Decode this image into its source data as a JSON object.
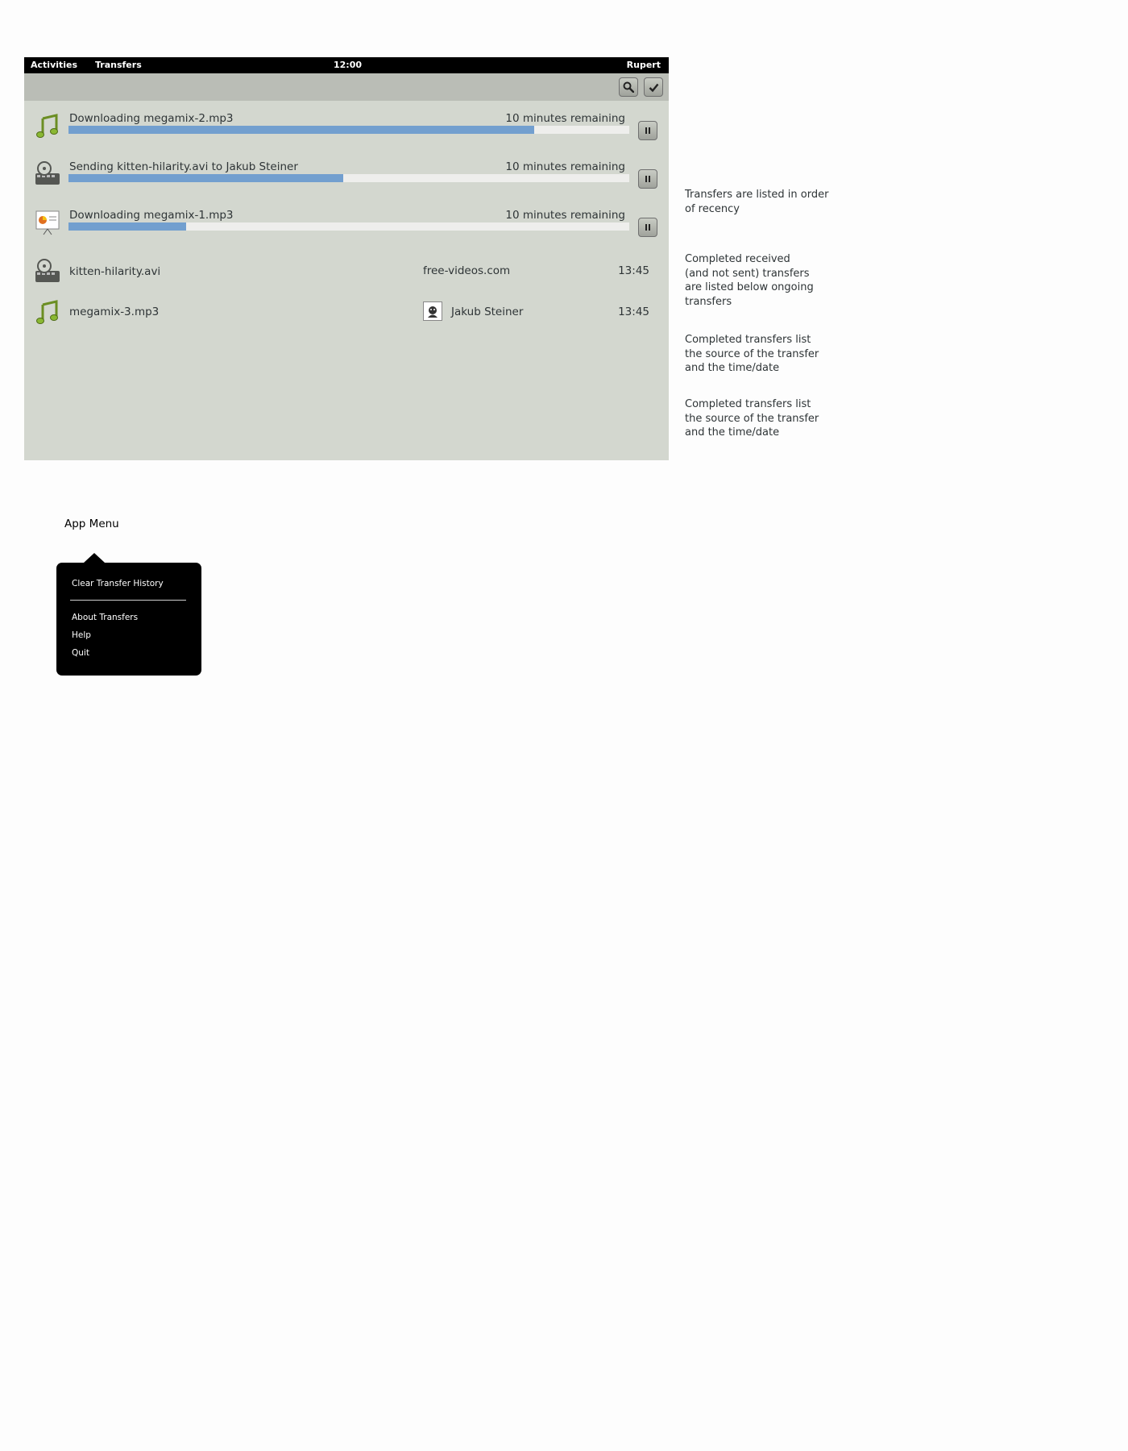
{
  "topbar": {
    "activities": "Activities",
    "app_name": "Transfers",
    "clock": "12:00",
    "user": "Rupert"
  },
  "toolbar": {
    "search_icon": "search-icon",
    "select_icon": "checkmark-icon"
  },
  "ongoing": [
    {
      "title": "Downloading megamix-2.mp3",
      "remaining": "10 minutes remaining",
      "progress": 0.83,
      "icon": "audio-file-icon"
    },
    {
      "title": "Sending kitten-hilarity.avi to Jakub Steiner",
      "remaining": "10 minutes remaining",
      "progress": 0.49,
      "icon": "video-file-icon"
    },
    {
      "title": "Downloading megamix-1.mp3",
      "remaining": "10 minutes remaining",
      "progress": 0.21,
      "icon": "presentation-file-icon"
    }
  ],
  "completed": [
    {
      "name": "kitten-hilarity.avi",
      "source": "free-videos.com",
      "time": "13:45",
      "icon": "video-file-icon"
    },
    {
      "name": "megamix-3.mp3",
      "source": "Jakub Steiner",
      "time": "13:45",
      "icon": "audio-file-icon",
      "avatar": true
    }
  ],
  "notes": [
    "Transfers are listed in order\nof recency",
    "Completed received\n(and not sent) transfers\nare listed below ongoing\ntransfers",
    "Completed transfers list\nthe source of the transfer\nand the time/date",
    "Completed transfers list\nthe source of the transfer\nand the time/date"
  ],
  "app_menu": {
    "caption": "App Menu",
    "items": [
      "Clear Transfer History",
      "About Transfers",
      "Help",
      "Quit"
    ]
  },
  "colors": {
    "window_bg": "#d3d7cf",
    "toolbar_bg": "#babdb6",
    "progress_fill": "#729fcf",
    "progress_track": "#eeeeec",
    "topbar_bg": "#000000"
  }
}
